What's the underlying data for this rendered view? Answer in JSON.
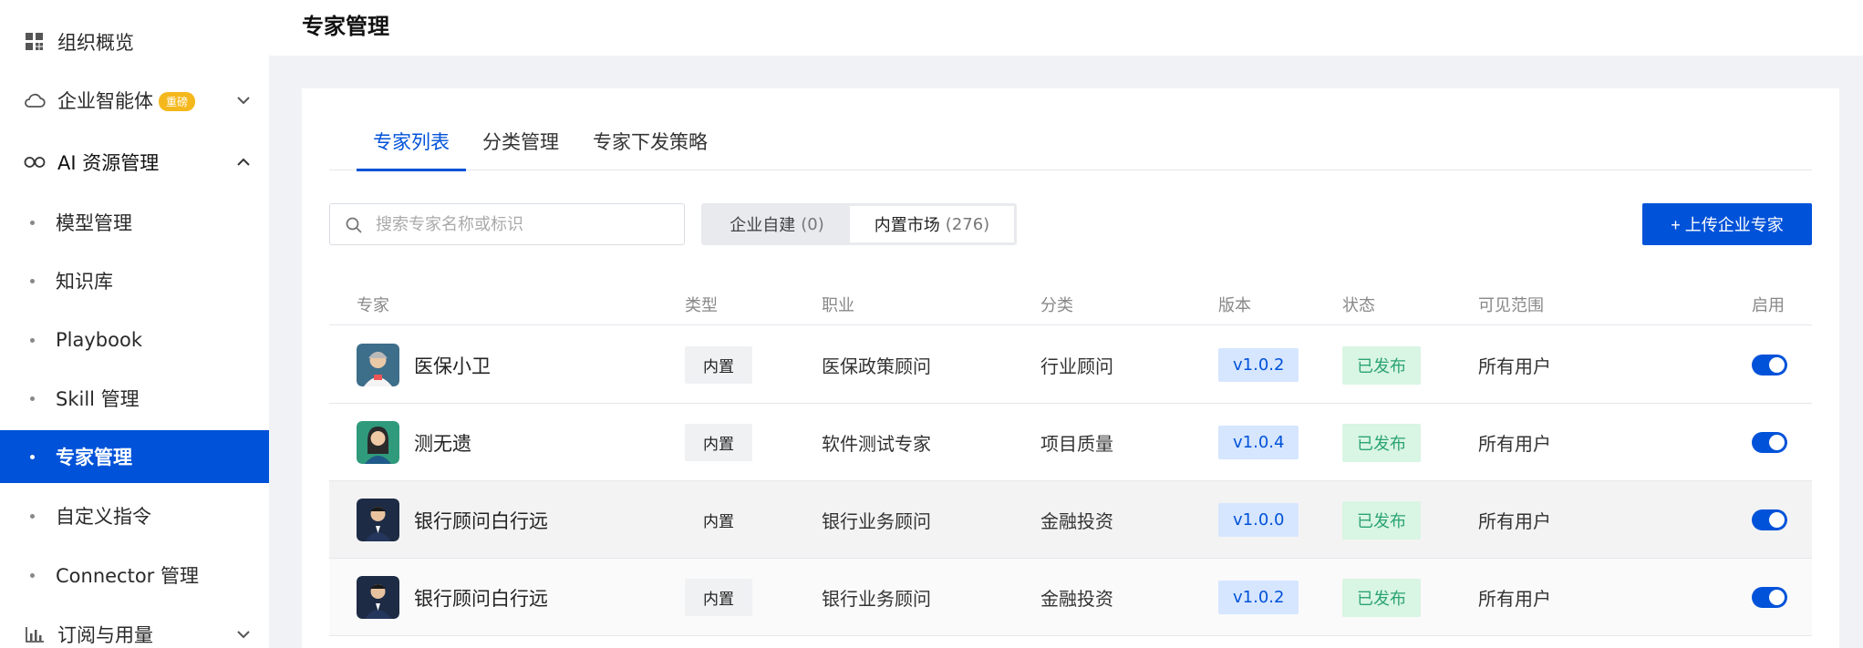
{
  "sidebar": {
    "items": [
      {
        "label": "组织概览",
        "icon": "grid-icon"
      },
      {
        "label": "企业智能体",
        "icon": "cloud-icon",
        "badge": "重磅"
      },
      {
        "label": "AI 资源管理",
        "icon": "infinity-icon"
      }
    ],
    "sub_items": [
      {
        "label": "模型管理"
      },
      {
        "label": "知识库"
      },
      {
        "label": "Playbook"
      },
      {
        "label": "Skill 管理"
      },
      {
        "label": "专家管理"
      },
      {
        "label": "自定义指令"
      },
      {
        "label": "Connector 管理"
      }
    ],
    "bottom_item": {
      "label": "订阅与用量",
      "icon": "bar-chart-icon"
    }
  },
  "header": {
    "title": "专家管理"
  },
  "tabs": [
    {
      "label": "专家列表"
    },
    {
      "label": "分类管理"
    },
    {
      "label": "专家下发策略"
    }
  ],
  "search": {
    "placeholder": "搜索专家名称或标识",
    "value": ""
  },
  "segment": {
    "enterprise_label": "企业自建",
    "enterprise_count": "(0)",
    "market_label": "内置市场",
    "market_count": "(276)"
  },
  "upload_button": "+ 上传企业专家",
  "table": {
    "columns": [
      "专家",
      "类型",
      "职业",
      "分类",
      "版本",
      "状态",
      "可见范围",
      "启用"
    ],
    "rows": [
      {
        "name": "医保小卫",
        "type": "内置",
        "job": "医保政策顾问",
        "category": "行业顾问",
        "version": "v1.0.2",
        "status": "已发布",
        "scope": "所有用户",
        "enabled": true
      },
      {
        "name": "测无遗",
        "type": "内置",
        "job": "软件测试专家",
        "category": "项目质量",
        "version": "v1.0.4",
        "status": "已发布",
        "scope": "所有用户",
        "enabled": true
      },
      {
        "name": "银行顾问白行远",
        "type": "内置",
        "job": "银行业务顾问",
        "category": "金融投资",
        "version": "v1.0.0",
        "status": "已发布",
        "scope": "所有用户",
        "enabled": true
      },
      {
        "name": "银行顾问白行远",
        "type": "内置",
        "job": "银行业务顾问",
        "category": "金融投资",
        "version": "v1.0.2",
        "status": "已发布",
        "scope": "所有用户",
        "enabled": true
      }
    ]
  },
  "colors": {
    "primary": "#0052d9",
    "published": "#2ba471",
    "hot_badge": "#f5b81c"
  }
}
